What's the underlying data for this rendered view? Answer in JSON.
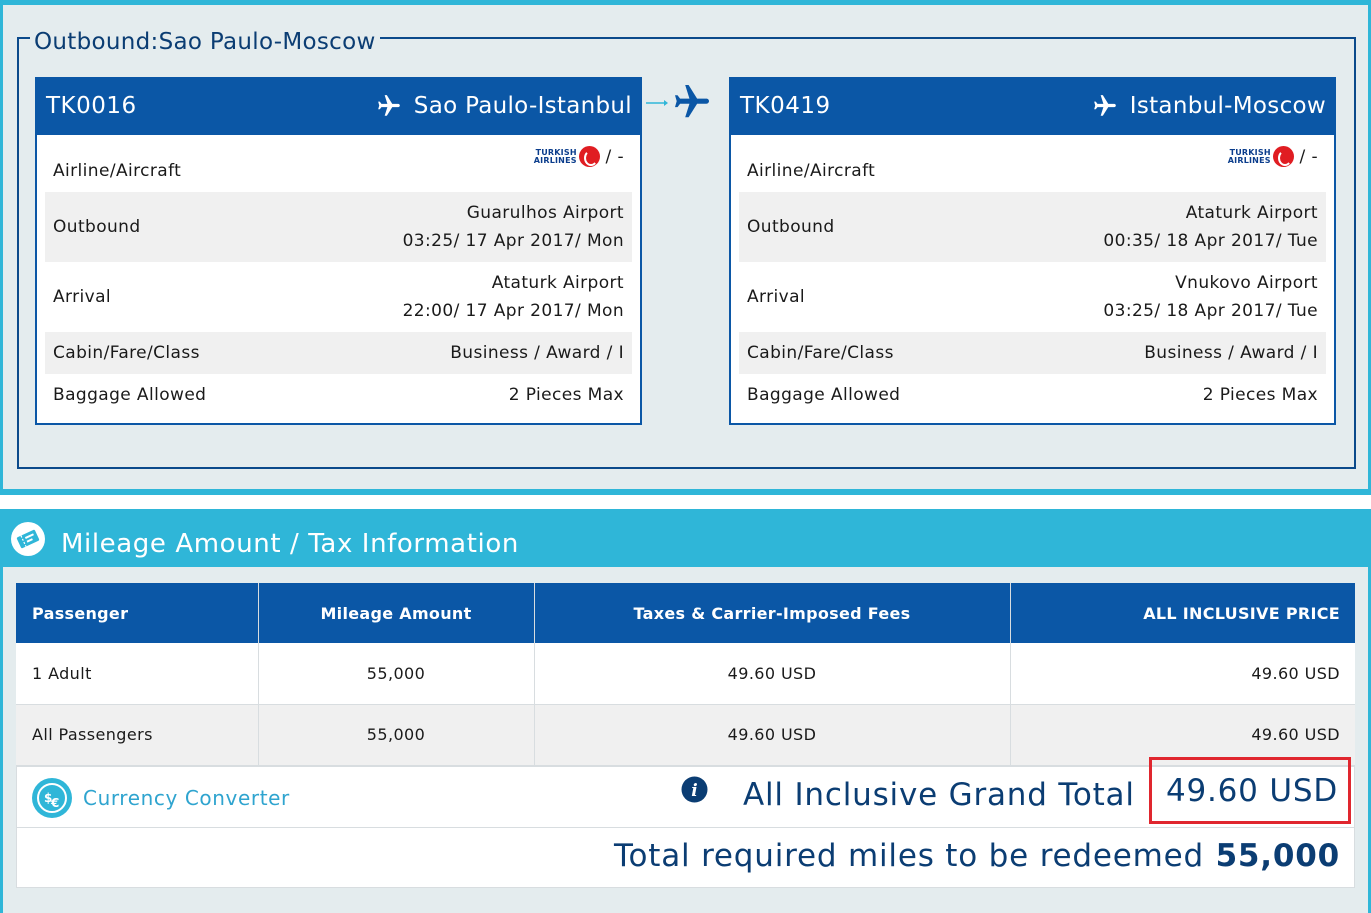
{
  "outbound": {
    "legend": "Outbound:Sao Paulo-Moscow",
    "flights": [
      {
        "flight_no": "TK0016",
        "route": "Sao Paulo-Istanbul",
        "airline_logo_text": "TURKISH AIRLINES",
        "labels": {
          "airline": "Airline/Aircraft",
          "outbound": "Outbound",
          "arrival": "Arrival",
          "cabin": "Cabin/Fare/Class",
          "baggage": "Baggage Allowed"
        },
        "aircraft": "/ -",
        "outbound_airport": "Guarulhos Airport",
        "outbound_time": "03:25/ 17 Apr 2017/ Mon",
        "arrival_airport": "Ataturk Airport",
        "arrival_time": "22:00/ 17 Apr 2017/ Mon",
        "cabin": "Business / Award / I",
        "baggage": "2 Pieces Max"
      },
      {
        "flight_no": "TK0419",
        "route": "Istanbul-Moscow",
        "airline_logo_text": "TURKISH AIRLINES",
        "labels": {
          "airline": "Airline/Aircraft",
          "outbound": "Outbound",
          "arrival": "Arrival",
          "cabin": "Cabin/Fare/Class",
          "baggage": "Baggage Allowed"
        },
        "aircraft": "/ -",
        "outbound_airport": "Ataturk Airport",
        "outbound_time": "00:35/ 18 Apr 2017/ Tue",
        "arrival_airport": "Vnukovo Airport",
        "arrival_time": "03:25/ 18 Apr 2017/ Tue",
        "cabin": "Business / Award / I",
        "baggage": "2 Pieces Max"
      }
    ]
  },
  "mileage": {
    "title": "Mileage Amount / Tax Information",
    "headers": [
      "Passenger",
      "Mileage Amount",
      "Taxes & Carrier-Imposed Fees",
      "ALL INCLUSIVE PRICE"
    ],
    "rows": [
      [
        "1 Adult",
        "55,000",
        "49.60 USD",
        "49.60 USD"
      ],
      [
        "All Passengers",
        "55,000",
        "49.60 USD",
        "49.60 USD"
      ]
    ],
    "currency_converter": "Currency Converter",
    "grand_total_label": "All Inclusive Grand Total",
    "grand_total_value": "49.60 USD",
    "miles_label": "Total required miles to be redeemed",
    "miles_value": "55,000"
  },
  "colors": {
    "dark_blue": "#0b57a6",
    "light_blue": "#2fb6d8",
    "text_navy": "#0b3d73",
    "highlight_red": "#e0262e",
    "panel_bg": "#e4ecee"
  },
  "icons": [
    "plane-icon",
    "arrow-plane-icon",
    "ticket-icon",
    "currency-converter-icon",
    "info-icon"
  ]
}
